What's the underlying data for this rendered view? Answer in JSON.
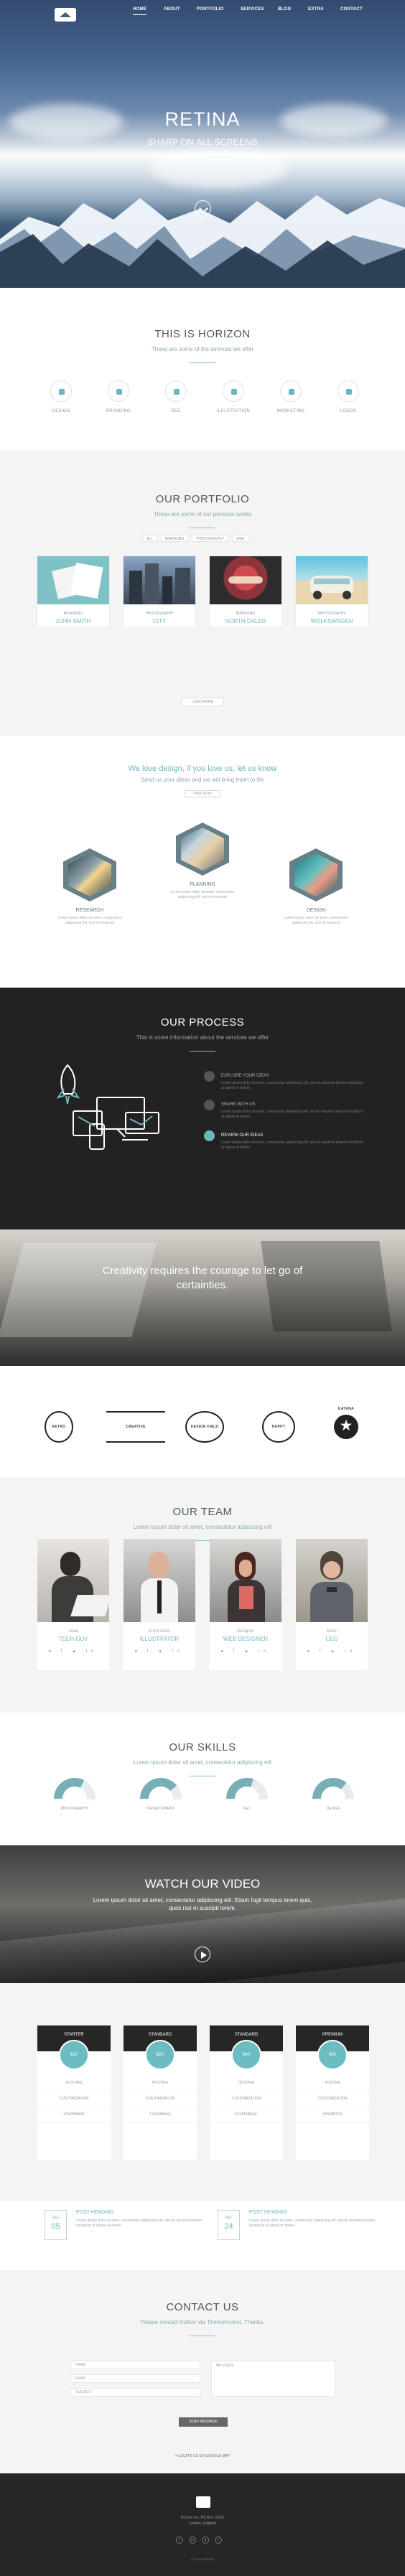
{
  "nav": {
    "items": [
      "HOME",
      "ABOUT",
      "PORTFOLIO",
      "SERVICES",
      "BLOG",
      "EXTRA",
      "CONTACT"
    ]
  },
  "hero": {
    "title": "RETINA",
    "subtitle": "SHARP ON ALL SCREENS"
  },
  "services": {
    "title": "THIS IS HORIZON",
    "subtitle": "These are some of the services we offer",
    "items": [
      "DESIGN",
      "BRANDING",
      "SEO",
      "ILLUSTRATION",
      "MARKETING",
      "LOGOS"
    ]
  },
  "portfolio": {
    "title": "OUR PORTFOLIO",
    "subtitle": "These are some of our previous works",
    "filters": [
      "ALL",
      "BRANDING",
      "PHOTOGRAPHY",
      "WEB"
    ],
    "items": [
      {
        "category": "BRANDING",
        "title": "JOHN SMITH"
      },
      {
        "category": "PHOTOGRAPHY",
        "title": "CITY"
      },
      {
        "category": "BRANDING",
        "title": "NORTH DALER"
      },
      {
        "category": "PHOTOGRAPHY",
        "title": "WOLKSWAGEN"
      }
    ],
    "load_more": "LOAD MORE"
  },
  "process_intro": {
    "title": "We love design, if you love us, let us know",
    "subtitle": "Send us your ideas and we will bring them to life",
    "button": "HIRE NOW"
  },
  "process_steps": [
    {
      "title": "RESEARCH",
      "text": "Lorem ipsum dolor sit amet, consectetur adipiscing elit, sed do eiusmod"
    },
    {
      "title": "PLANNING",
      "text": "Lorem ipsum dolor sit amet, consectetur adipiscing elit, sed do eiusmod"
    },
    {
      "title": "DESIGN",
      "text": "Lorem ipsum dolor sit amet, consectetur adipiscing elit, sed do eiusmod"
    }
  ],
  "dark": {
    "title": "OUR PROCESS",
    "subtitle": "This is some information about the services we offer",
    "steps": [
      {
        "title": "EXPLORE YOUR IDEAS",
        "text": "Lorem ipsum dolor sit amet, consectetur adipiscing elit, sed do eiusmod tempor incididunt ut labore et dolore."
      },
      {
        "title": "SHARE WITH US",
        "text": "Lorem ipsum dolor sit amet, consectetur adipiscing elit, sed do eiusmod tempor incididunt ut labore et dolore."
      },
      {
        "title": "REVIEW OUR IDEAS",
        "text": "Lorem ipsum dolor sit amet, consectetur adipiscing elit, sed do eiusmod tempor incididunt ut labore et dolore."
      }
    ]
  },
  "quote": {
    "text": "Creativity requires the courage to let go of certainties."
  },
  "clients": [
    "RETRO",
    "CREATIVE",
    "DESIGN FIELD",
    "HAPPY",
    "KATANA"
  ],
  "team": {
    "title": "OUR TEAM",
    "subtitle": "Lorem ipsum dolor sit amet, consectetur adipiscing elit",
    "members": [
      {
        "role": "Lead",
        "name": "TECH GUY"
      },
      {
        "role": "Front Artist",
        "name": "ILLUSTRATOR"
      },
      {
        "role": "Designer",
        "name": "WEB DESIGNER"
      },
      {
        "role": "Boss",
        "name": "CEO"
      }
    ]
  },
  "skills": {
    "title": "OUR SKILLS",
    "subtitle": "Lorem ipsum dolor sit amet, consectetur adipiscing elit",
    "items": [
      {
        "name": "PHOTOGRAPHY",
        "value": 0.65
      },
      {
        "name": "DEVELOPMENT",
        "value": 0.78
      },
      {
        "name": "SEO",
        "value": 0.6
      },
      {
        "name": "DESIGN",
        "value": 0.72
      }
    ]
  },
  "video": {
    "title": "WATCH OUR VIDEO",
    "text": "Lorem ipsum dolor sit amet, consectetur adipiscing elit. Etiam fugit tempus lorem quis, quos nisi et suscipit lorem."
  },
  "pricing": [
    {
      "name": "STARTER",
      "price": "$10",
      "features": [
        "HOSTING",
        "CUSTOMIZATION",
        "1 DATABASE"
      ]
    },
    {
      "name": "STANDARD",
      "price": "$20",
      "features": [
        "HOSTING",
        "CUSTOMIZATION",
        "3 DATABASE"
      ]
    },
    {
      "name": "STANDARD",
      "price": "$40",
      "features": [
        "HOSTING",
        "CUSTOMIZATION",
        "5 DATABASE"
      ]
    },
    {
      "name": "PREMIUM",
      "price": "$80",
      "features": [
        "HOSTING",
        "CUSTOMIZATION",
        "UNLIMITED"
      ]
    }
  ],
  "posts": [
    {
      "month": "DEC",
      "day": "05",
      "title": "POST HEADING",
      "text": "Lorem ipsum dolor sit amet, consectetur adipiscing elit, sed do eiusmod tempor incididunt ut labore et dolore."
    },
    {
      "month": "DEC",
      "day": "24",
      "title": "POST HEADING",
      "text": "Lorem ipsum dolor sit amet, consectetur adipiscing elit, sed do eiusmod tempor incididunt ut labore et dolore."
    }
  ],
  "contact": {
    "title": "CONTACT US",
    "subtitle": "Please contact Author via ThemeForest. Thanks.",
    "name_placeholder": "NAME",
    "email_placeholder": "EMAIL",
    "subject_placeholder": "SUBJECT",
    "message_placeholder": "MESSAGE",
    "button": "SEND MESSAGE",
    "location": "LOCATE US ON GOOGLE MAP"
  },
  "footer": {
    "address": "Horizon Inc. PO Box 16122\nLondon, England",
    "copyright": "© 2013 HORIZON"
  }
}
